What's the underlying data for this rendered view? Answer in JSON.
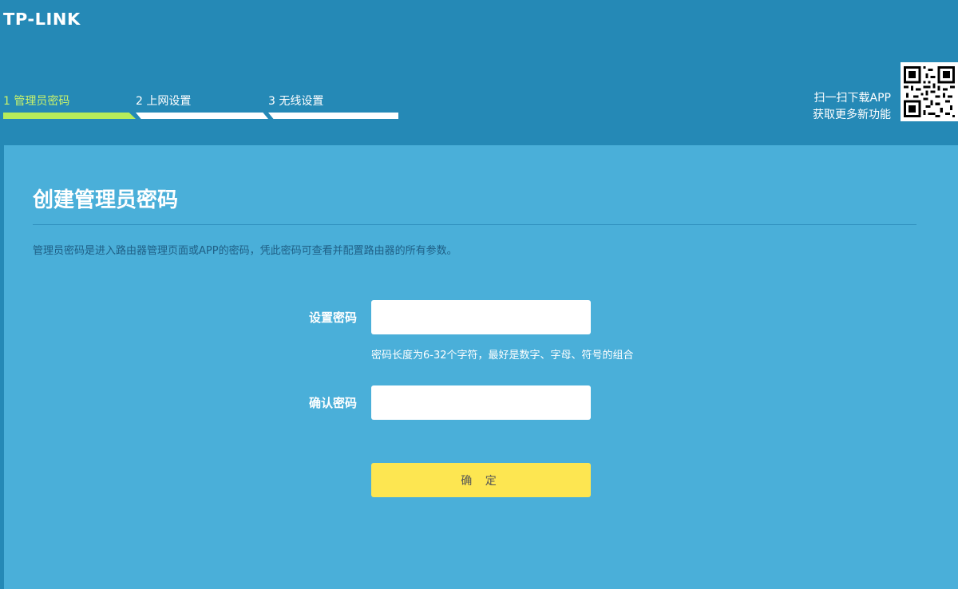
{
  "header": {
    "logo": "TP-LINK",
    "steps": [
      {
        "label": "1 管理员密码",
        "active": true
      },
      {
        "label": "2 上网设置",
        "active": false
      },
      {
        "label": "3 无线设置",
        "active": false
      }
    ],
    "app_promo": {
      "line1": "扫一扫下载APP",
      "line2": "获取更多新功能"
    }
  },
  "main": {
    "title": "创建管理员密码",
    "description": "管理员密码是进入路由器管理页面或APP的密码，凭此密码可查看并配置路由器的所有参数。",
    "form": {
      "password_label": "设置密码",
      "password_value": "",
      "password_hint": "密码长度为6-32个字符，最好是数字、字母、符号的组合",
      "confirm_label": "确认密码",
      "confirm_value": "",
      "submit_label": "确 定"
    }
  },
  "colors": {
    "header_bg": "#2589b6",
    "panel_bg": "#4aafd9",
    "active_step": "#b7ec5b",
    "button": "#fde651"
  }
}
